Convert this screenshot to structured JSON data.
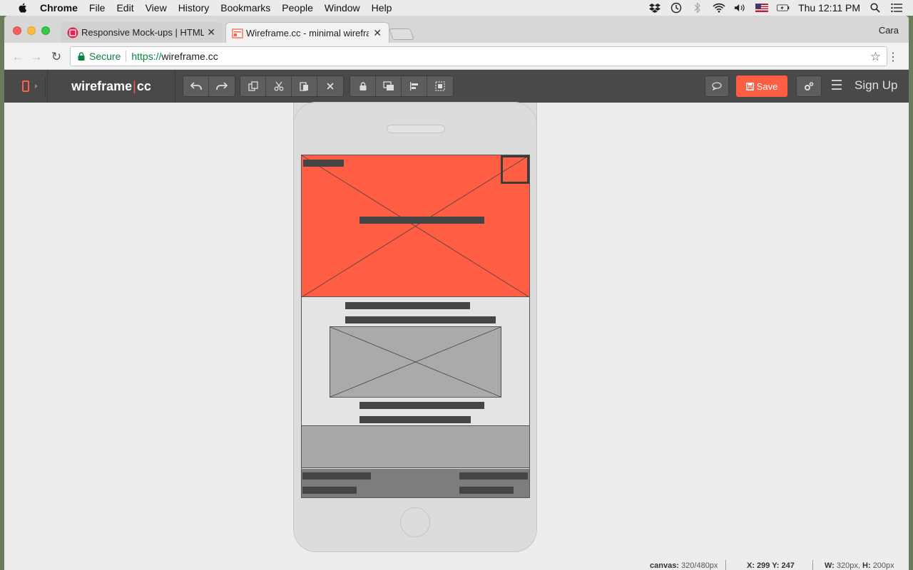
{
  "menubar": {
    "app": "Chrome",
    "items": [
      "File",
      "Edit",
      "View",
      "History",
      "Bookmarks",
      "People",
      "Window",
      "Help"
    ],
    "clock": "Thu 12:11 PM"
  },
  "browser": {
    "tabs": [
      {
        "title": "Responsive Mock-ups | HTML, CSS",
        "active": false
      },
      {
        "title": "Wireframe.cc - minimal wireframing tool",
        "active": true
      }
    ],
    "profile": "Cara",
    "address": {
      "secure_label": "Secure",
      "scheme": "https://",
      "host": "wireframe.cc"
    }
  },
  "app": {
    "brand_left": "wireframe",
    "brand_sep": "|",
    "brand_right": "cc",
    "save_label": "Save",
    "signup_label": "Sign Up",
    "accent_color": "#ff5e45"
  },
  "status": {
    "canvas_label": "canvas:",
    "canvas_value": "320/480px",
    "xy_label": "X: 299 Y: 247",
    "wh_w_label": "W:",
    "wh_w_value": "320px,",
    "wh_h_label": "H:",
    "wh_h_value": "200px"
  }
}
